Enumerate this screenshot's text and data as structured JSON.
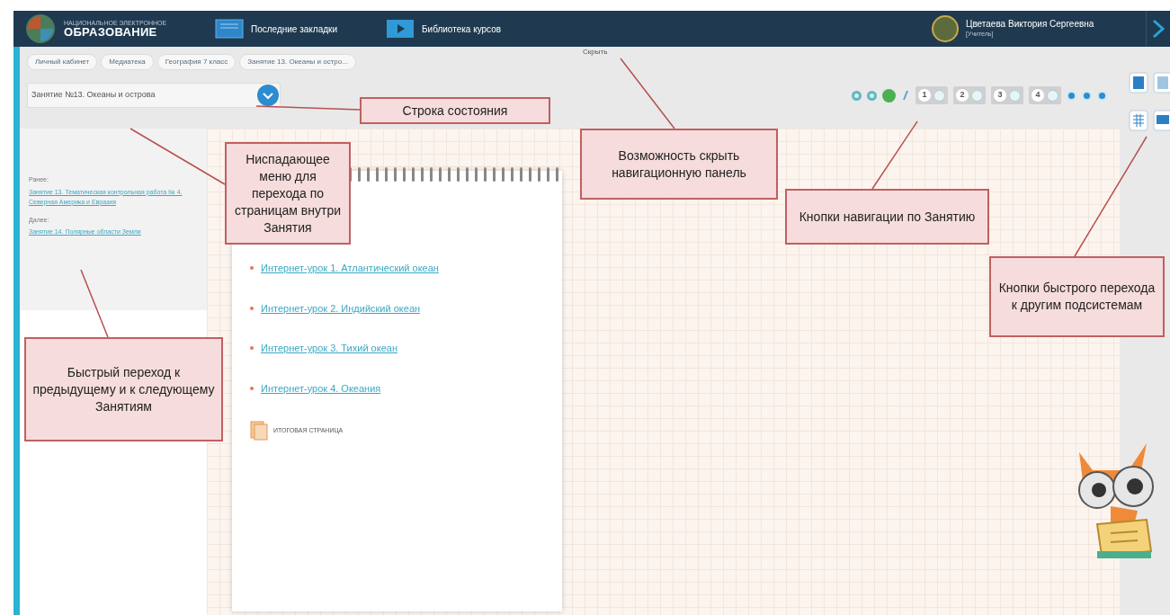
{
  "header": {
    "logo_small": "НАЦИОНАЛЬНОЕ ЭЛЕКТРОННОЕ",
    "logo": "ОБРАЗОВАНИЕ",
    "links": [
      {
        "kind": "bookmarks",
        "text": "Последние закладки"
      },
      {
        "kind": "library",
        "text": "Библиотека курсов"
      }
    ],
    "user": {
      "name": "Цветаева Виктория Сергеевна",
      "role": "[Учитель]"
    }
  },
  "breadcrumbs": [
    "Личный кабинет",
    "Медиатека",
    "География 7 класс",
    "Занятие 13. Океаны и остро..."
  ],
  "hide_link": "Скрыть",
  "lesson_select": {
    "value": "Занятие №13. Океаны и острова"
  },
  "lesson_nav": [
    {
      "kind": "dot"
    },
    {
      "kind": "dot"
    },
    {
      "kind": "current"
    },
    {
      "kind": "pencil"
    },
    {
      "kind": "step",
      "label": "1"
    },
    {
      "kind": "step",
      "label": "2"
    },
    {
      "kind": "step",
      "label": "3"
    },
    {
      "kind": "step",
      "label": "4"
    },
    {
      "kind": "blue-dot"
    },
    {
      "kind": "blue-dot"
    },
    {
      "kind": "blue-dot"
    }
  ],
  "sidebar": {
    "prev_label": "Ранее:",
    "prev_link": "Занятие 13. Тематическая контрольная работа № 4. Северная Америка и Евразия",
    "next_label": "Далее:",
    "next_link": "Занятие 14. Полярные области Земли"
  },
  "content": [
    {
      "kind": "link",
      "text": "Интернет-урок 1. Атлантический океан"
    },
    {
      "kind": "link",
      "text": "Интернет-урок 2. Индийский океан"
    },
    {
      "kind": "link",
      "text": "Интернет-урок 3. Тихий океан"
    },
    {
      "kind": "link",
      "text": "Интернет-урок 4. Океания"
    },
    {
      "kind": "summary",
      "text": "ИТОГОВАЯ СТРАНИЦА"
    }
  ],
  "callouts": [
    "Строка состояния",
    "Ниспадающее меню для перехода по страницам внутри Занятия",
    "Возможность скрыть навигационную панель",
    "Кнопки навигации по Занятию",
    "Кнопки быстрого перехода к другим подсистемам",
    "Быстрый переход к предыдущему и к следующему Занятиям"
  ]
}
